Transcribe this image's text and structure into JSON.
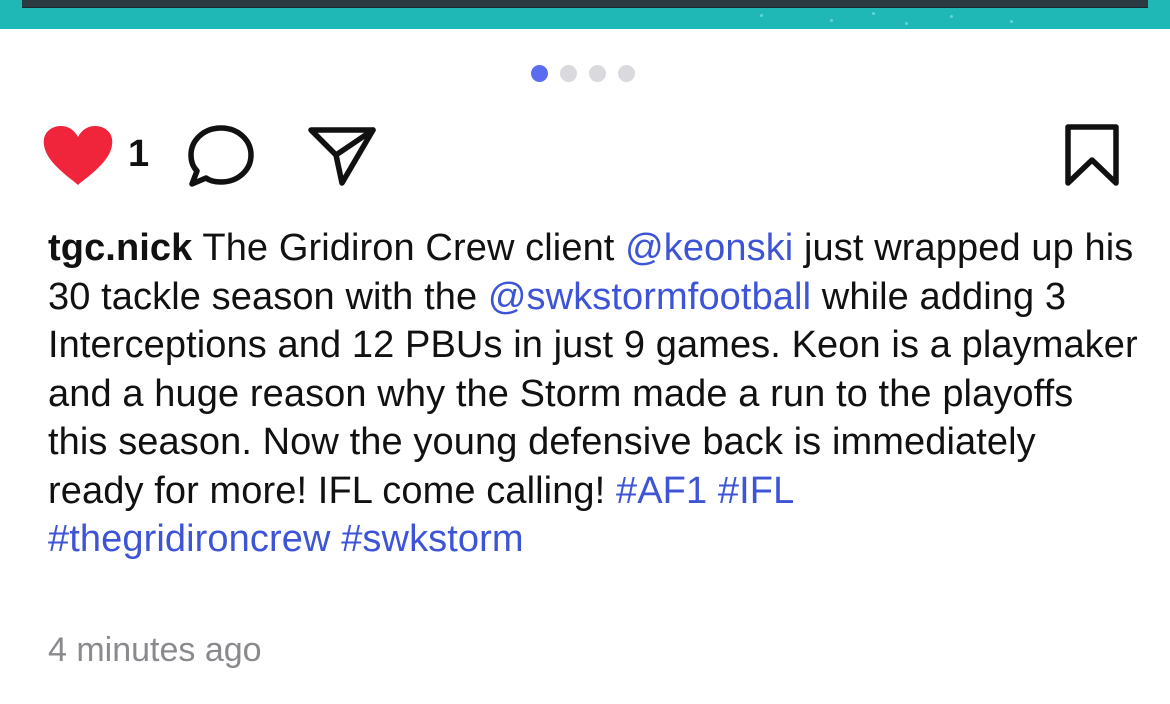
{
  "pager": {
    "total": 4,
    "active_index": 0
  },
  "actions": {
    "like_icon": "heart-filled-icon",
    "like_count": "1",
    "comment_icon": "speech-bubble-icon",
    "share_icon": "paper-plane-icon",
    "bookmark_icon": "bookmark-icon"
  },
  "post": {
    "username": "tgc.nick",
    "caption_parts": [
      " The Gridiron Crew client ",
      "@keonski",
      " just wrapped up his 30 tackle season with the ",
      "@swkstormfootball",
      " while adding 3 Interceptions and 12 PBUs in just 9 games. Keon is a playmaker and a huge reason why the Storm made a run to the playoffs this season. Now the young defensive back is immediately ready for more! IFL come calling! ",
      "#AF1",
      " ",
      "#IFL",
      " ",
      "#thegridironcrew",
      " ",
      "#swkstorm"
    ],
    "timestamp": "4 minutes ago"
  },
  "colors": {
    "link": "#3d54d6",
    "heart": "#f0243a",
    "pager_active": "#5a6cf2",
    "pager_inactive": "#d9d9de",
    "media_teal": "#20b8b6"
  }
}
